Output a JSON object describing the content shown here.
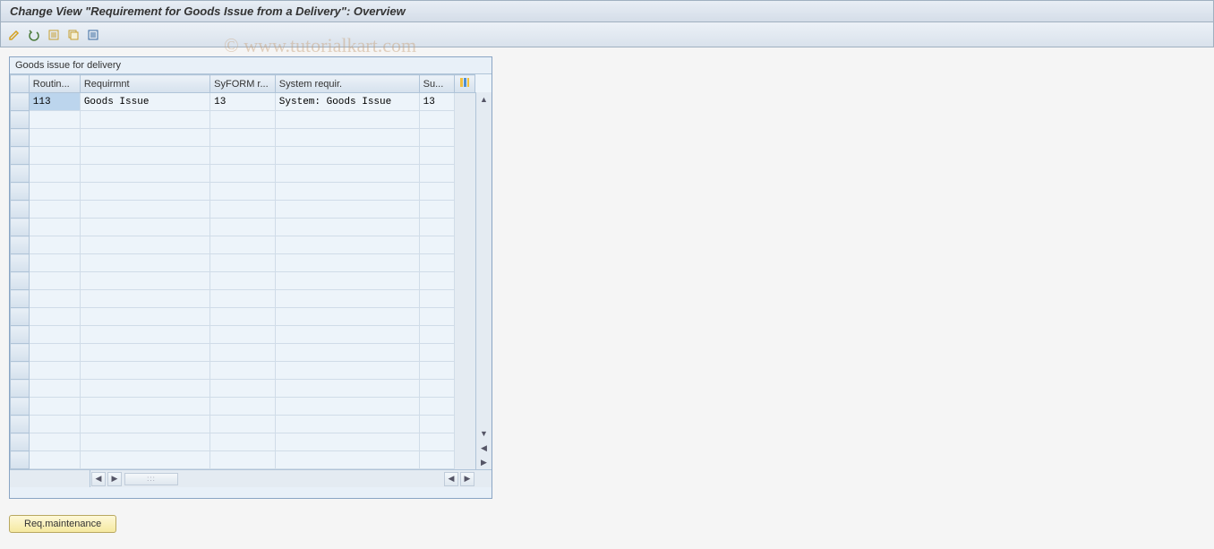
{
  "title": "Change View \"Requirement for Goods Issue from a Delivery\": Overview",
  "toolbar": {
    "icons": [
      "edit-icon",
      "undo-icon",
      "new-entries-icon",
      "copy-icon",
      "delete-icon"
    ]
  },
  "panel": {
    "title": "Goods issue for delivery"
  },
  "table": {
    "columns": [
      "Routin...",
      "Requirmnt",
      "SyFORM r...",
      "System requir.",
      "Su..."
    ],
    "rows": [
      {
        "routin": "113",
        "requirmnt": "Goods Issue",
        "syform": "13",
        "system_requir": "System: Goods Issue",
        "su": "13"
      }
    ],
    "empty_rows": 20
  },
  "button": {
    "req_maintenance": "Req.maintenance"
  },
  "watermark": "© www.tutorialkart.com"
}
